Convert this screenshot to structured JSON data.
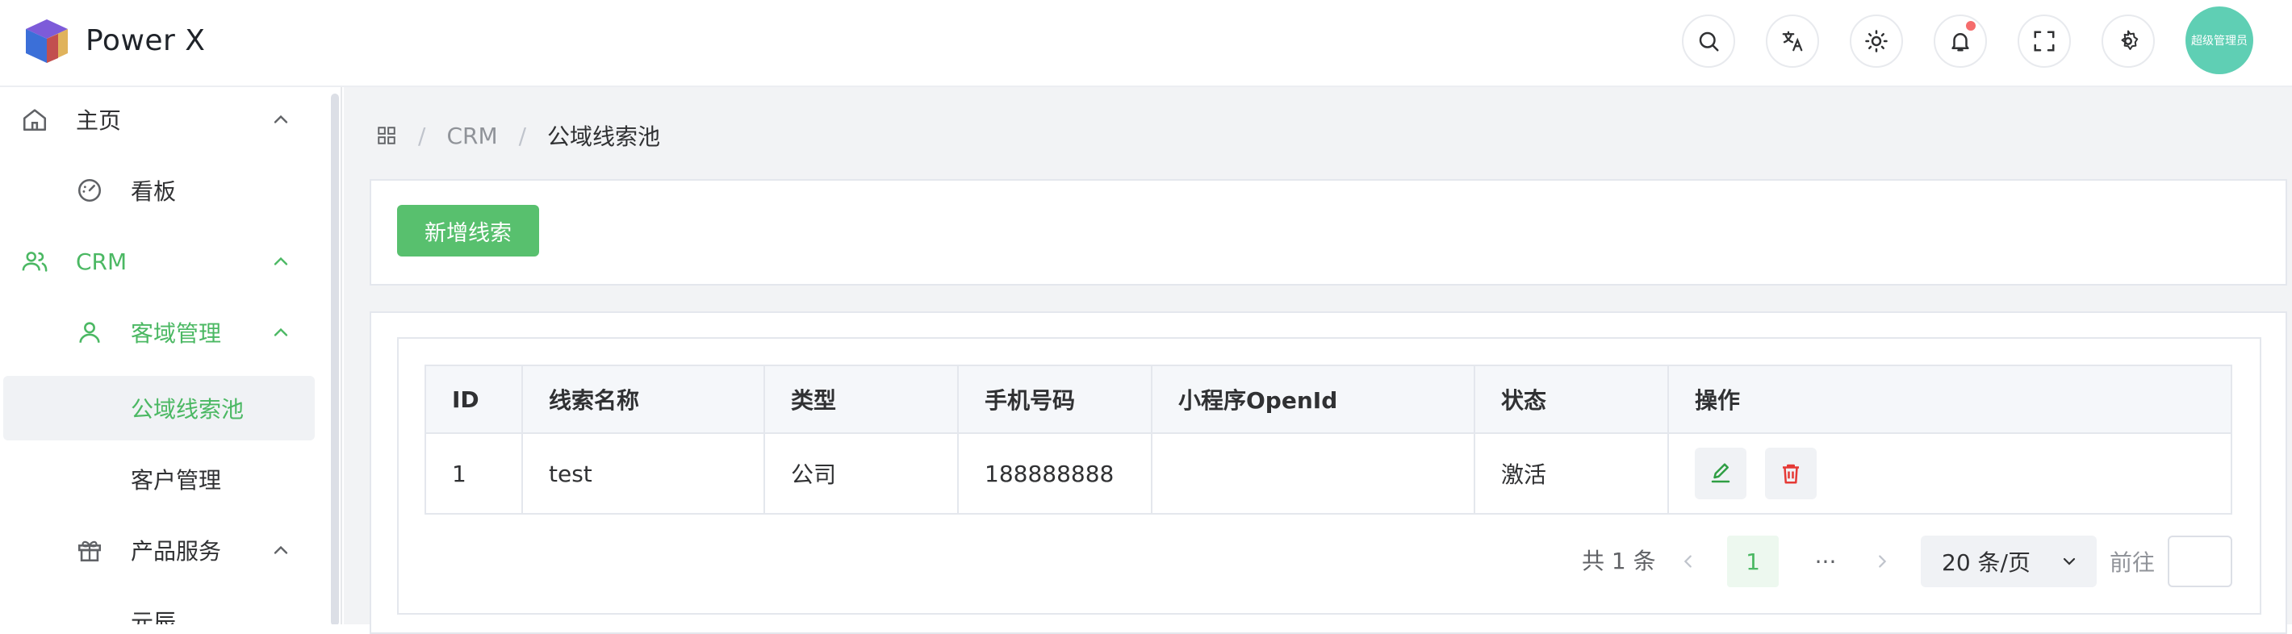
{
  "app": {
    "title": "Power X"
  },
  "header": {
    "avatar_text": "超级管理员",
    "buttons": [
      "search-icon",
      "translate-icon",
      "theme-icon",
      "bell-icon",
      "fullscreen-icon",
      "gear-icon"
    ]
  },
  "sidebar": {
    "items": [
      {
        "label": "主页",
        "icon": "home-icon"
      },
      {
        "label": "看板",
        "icon": "dashboard-icon"
      },
      {
        "label": "CRM",
        "icon": "users-icon"
      },
      {
        "label": "客域管理",
        "icon": "user-icon"
      },
      {
        "label": "公域线索池"
      },
      {
        "label": "客户管理"
      },
      {
        "label": "产品服务",
        "icon": "gift-icon"
      },
      {
        "label": "元辰"
      }
    ]
  },
  "breadcrumb": {
    "items": [
      "CRM",
      "公域线索池"
    ]
  },
  "toolbar": {
    "add_label": "新增线索"
  },
  "table": {
    "columns": [
      "ID",
      "线索名称",
      "类型",
      "手机号码",
      "小程序OpenId",
      "状态",
      "操作"
    ],
    "rows": [
      {
        "id": "1",
        "name": "test",
        "type": "公司",
        "phone": "188888888",
        "openid": "",
        "status": "激活"
      }
    ]
  },
  "pagination": {
    "total": "共 1 条",
    "current_page": "1",
    "ellipsis": "···",
    "page_size": "20 条/页",
    "goto_label": "前往"
  },
  "colors": {
    "accent": "#58c06e",
    "danger": "#f56c6c",
    "avatar": "#5fcfb4"
  }
}
